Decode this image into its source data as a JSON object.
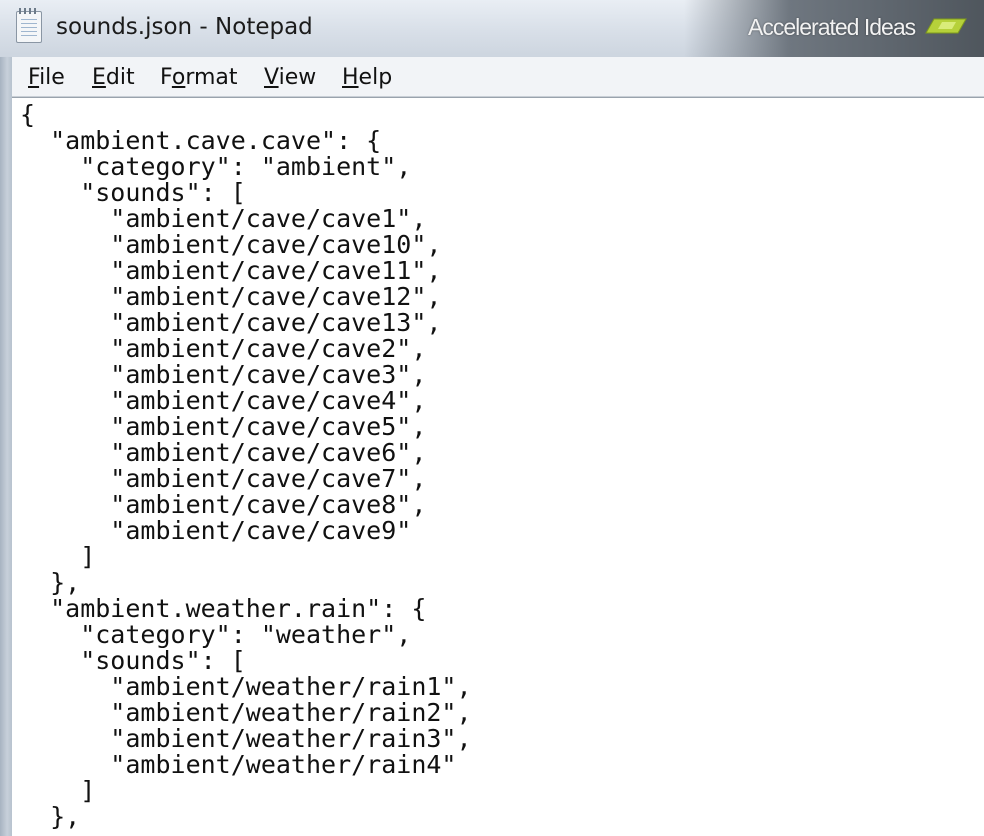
{
  "window": {
    "title": "sounds.json - Notepad",
    "watermark": "Accelerated Ideas"
  },
  "menu": [
    {
      "key": "F",
      "rest": "ile"
    },
    {
      "key": "E",
      "rest": "dit"
    },
    {
      "pre": "F",
      "key": "o",
      "rest": "rmat"
    },
    {
      "key": "V",
      "rest": "iew"
    },
    {
      "key": "H",
      "rest": "elp"
    }
  ],
  "editor": {
    "lines": [
      "{",
      "  \"ambient.cave.cave\": {",
      "    \"category\": \"ambient\",",
      "    \"sounds\": [",
      "      \"ambient/cave/cave1\",",
      "      \"ambient/cave/cave10\",",
      "      \"ambient/cave/cave11\",",
      "      \"ambient/cave/cave12\",",
      "      \"ambient/cave/cave13\",",
      "      \"ambient/cave/cave2\",",
      "      \"ambient/cave/cave3\",",
      "      \"ambient/cave/cave4\",",
      "      \"ambient/cave/cave5\",",
      "      \"ambient/cave/cave6\",",
      "      \"ambient/cave/cave7\",",
      "      \"ambient/cave/cave8\",",
      "      \"ambient/cave/cave9\"",
      "    ]",
      "  },",
      "  \"ambient.weather.rain\": {",
      "    \"category\": \"weather\",",
      "    \"sounds\": [",
      "      \"ambient/weather/rain1\",",
      "      \"ambient/weather/rain2\",",
      "      \"ambient/weather/rain3\",",
      "      \"ambient/weather/rain4\"",
      "    ]",
      "  },"
    ]
  },
  "icons": {
    "app": "notepad-icon",
    "watermark_logo": "accelerated-ideas-logo"
  },
  "colors": {
    "watermark_logo": "#b6d13a"
  }
}
